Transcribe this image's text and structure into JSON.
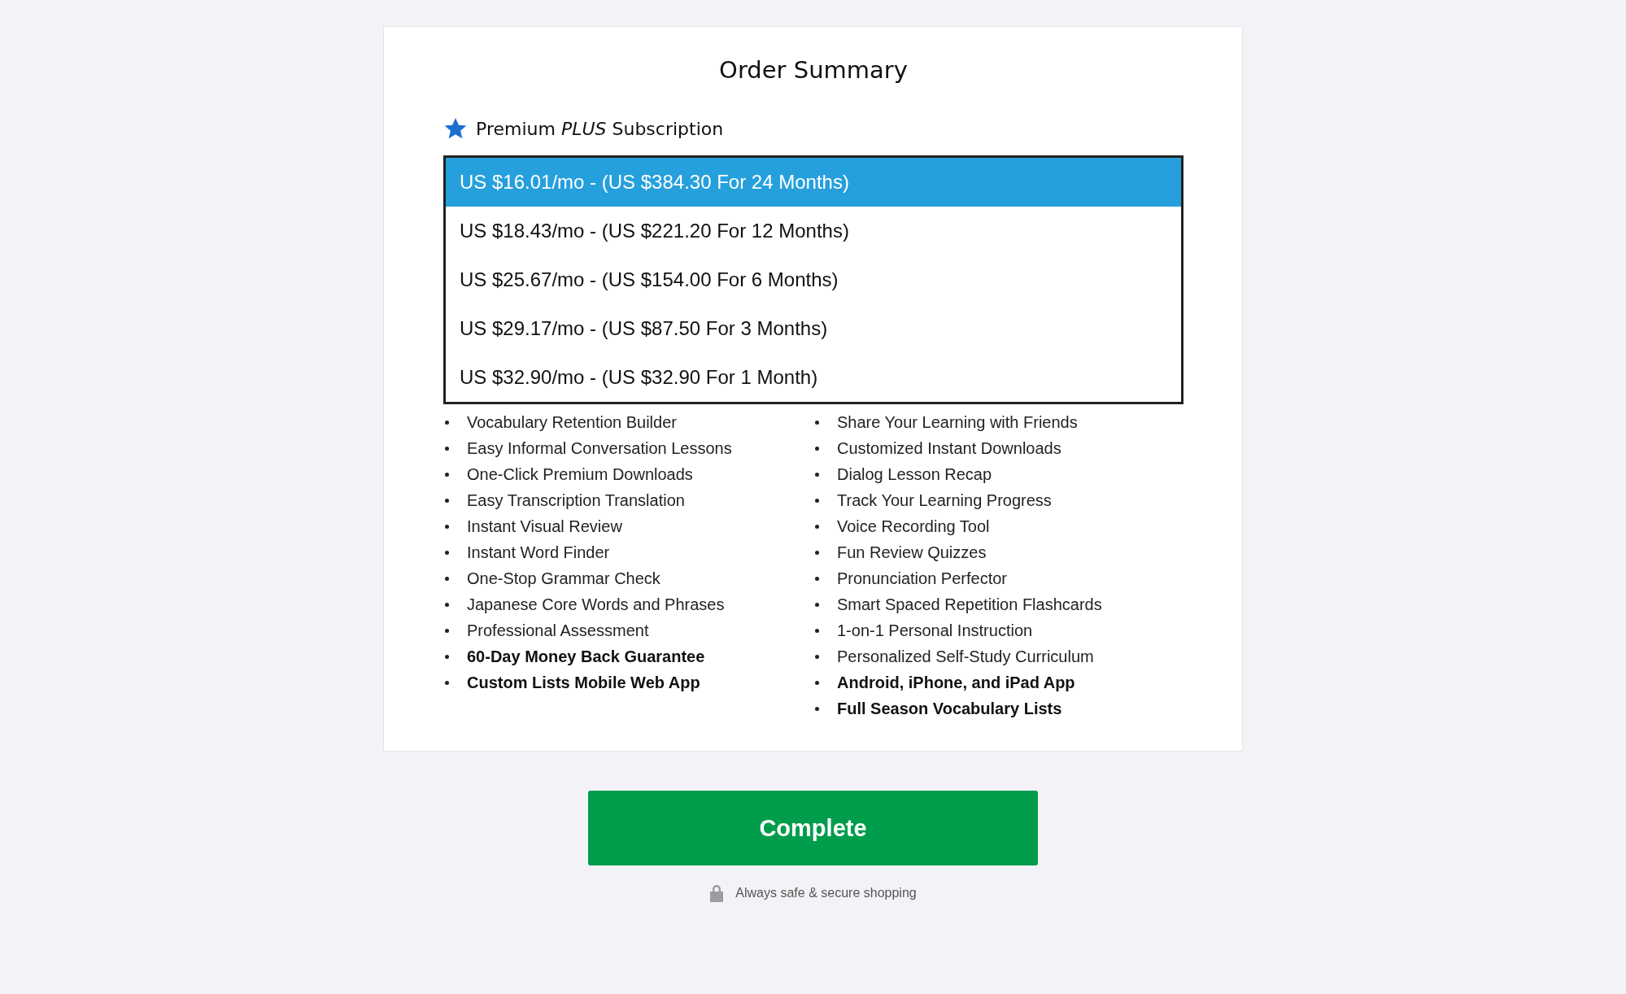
{
  "title": "Order Summary",
  "plan": {
    "name": "Premium *PLUS* Subscription"
  },
  "options": [
    {
      "label": "US $16.01/mo - (US $384.30 For 24 Months)",
      "selected": true
    },
    {
      "label": "US $18.43/mo - (US $221.20 For 12 Months)",
      "selected": false
    },
    {
      "label": "US $25.67/mo - (US $154.00 For 6 Months)",
      "selected": false
    },
    {
      "label": "US $29.17/mo - (US $87.50 For 3 Months)",
      "selected": false
    },
    {
      "label": "US $32.90/mo - (US $32.90 For 1 Month)",
      "selected": false
    }
  ],
  "features": [
    [
      {
        "text": "Vocabulary Retention Builder",
        "bold": false
      },
      {
        "text": "Easy Informal Conversation Lessons",
        "bold": false
      },
      {
        "text": "One-Click Premium Downloads",
        "bold": false
      },
      {
        "text": "Easy Transcription Translation",
        "bold": false
      },
      {
        "text": "Instant Visual Review",
        "bold": false
      },
      {
        "text": "Instant Word Finder",
        "bold": false
      },
      {
        "text": "One-Stop Grammar Check",
        "bold": false
      },
      {
        "text": "Japanese Core Words and Phrases",
        "bold": false
      },
      {
        "text": "Professional Assessment",
        "bold": false
      },
      {
        "text": "60-Day Money Back Guarantee",
        "bold": true
      },
      {
        "text": "Custom Lists Mobile Web App",
        "bold": true
      }
    ],
    [
      {
        "text": "Share Your Learning with Friends",
        "bold": false
      },
      {
        "text": "Customized Instant Downloads",
        "bold": false
      },
      {
        "text": "Dialog Lesson Recap",
        "bold": false
      },
      {
        "text": "Track Your Learning Progress",
        "bold": false
      },
      {
        "text": "Voice Recording Tool",
        "bold": false
      },
      {
        "text": "Fun Review Quizzes",
        "bold": false
      },
      {
        "text": "Pronunciation Perfector",
        "bold": false
      },
      {
        "text": "Smart Spaced Repetition Flashcards",
        "bold": false
      },
      {
        "text": "1-on-1 Personal Instruction",
        "bold": false
      },
      {
        "text": "Personalized Self-Study Curriculum",
        "bold": false
      },
      {
        "text": "Android, iPhone, and iPad App",
        "bold": true
      },
      {
        "text": "Full Season Vocabulary Lists",
        "bold": true
      }
    ]
  ],
  "button": "Complete",
  "footer": "Always safe & secure shopping"
}
